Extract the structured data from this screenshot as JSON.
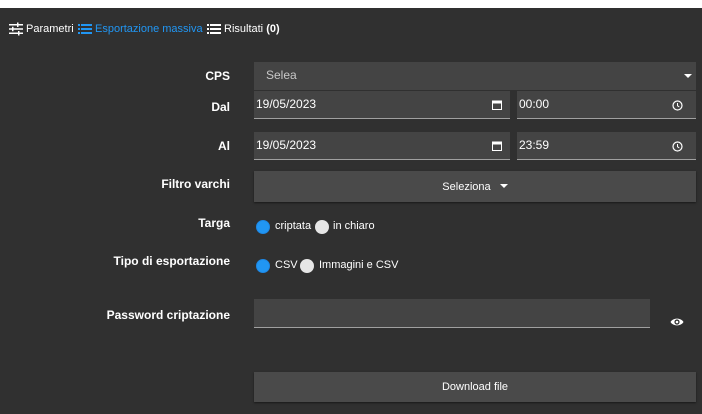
{
  "tabs": [
    {
      "label": "Parametri",
      "icon": "sliders-icon"
    },
    {
      "label": "Esportazione massiva",
      "icon": "list-icon"
    },
    {
      "label": "Risultati",
      "count": "(0)",
      "icon": "list-icon"
    }
  ],
  "form": {
    "cps": {
      "label": "CPS",
      "value": "Selea"
    },
    "dal": {
      "label": "Dal",
      "date": "19/05/2023",
      "time": "00:00"
    },
    "al": {
      "label": "Al",
      "date": "19/05/2023",
      "time": "23:59"
    },
    "filtro": {
      "label": "Filtro varchi",
      "button": "Seleziona"
    },
    "targa": {
      "label": "Targa",
      "options": [
        "criptata",
        "in chiaro"
      ],
      "selected": "criptata"
    },
    "tipo": {
      "label": "Tipo di esportazione",
      "options": [
        "CSV",
        "Immagini e CSV"
      ],
      "selected": "CSV"
    },
    "password": {
      "label": "Password criptazione",
      "value": ""
    },
    "download": {
      "label": "Download file"
    }
  },
  "colors": {
    "background": "#303030",
    "field": "#444444",
    "accent": "#2196f3"
  }
}
